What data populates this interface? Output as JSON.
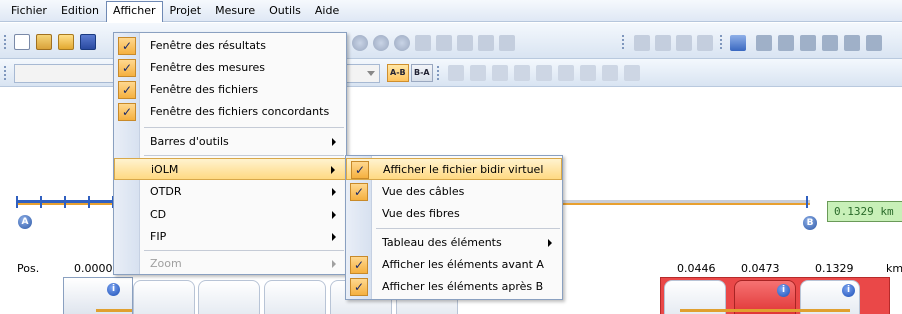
{
  "menubar": {
    "items": [
      "Fichier",
      "Edition",
      "Afficher",
      "Projet",
      "Mesure",
      "Outils",
      "Aide"
    ]
  },
  "toolbar": {
    "ab_label": "A-B",
    "ba_label": "B-A"
  },
  "afficher_menu": {
    "items": [
      {
        "label": "Fenêtre des résultats",
        "checked": true
      },
      {
        "label": "Fenêtre des mesures",
        "checked": true
      },
      {
        "label": "Fenêtre des fichiers",
        "checked": true
      },
      {
        "label": "Fenêtre des fichiers concordants",
        "checked": true
      },
      {
        "label": "Barres d'outils",
        "submenu": true
      },
      {
        "label": "iOLM",
        "submenu": true,
        "highlighted": true
      },
      {
        "label": "OTDR",
        "submenu": true
      },
      {
        "label": "CD",
        "submenu": true
      },
      {
        "label": "FIP",
        "submenu": true
      },
      {
        "label": "Zoom",
        "submenu": true,
        "disabled": true
      }
    ]
  },
  "iolm_submenu": {
    "items": [
      {
        "label": "Afficher le fichier bidir virtuel",
        "checked": true,
        "highlighted": true
      },
      {
        "label": "Vue des câbles",
        "checked": true
      },
      {
        "label": "Vue des fibres",
        "checked": false
      },
      {
        "label": "Tableau des éléments",
        "submenu": true
      },
      {
        "label": "Afficher les éléments avant A",
        "checked": true
      },
      {
        "label": "Afficher les éléments après B",
        "checked": true
      }
    ]
  },
  "trace": {
    "marker_a": "A",
    "marker_b": "B",
    "distance": "0.1329 km"
  },
  "positions": {
    "label": "Pos.",
    "start": "0.0000",
    "values": [
      "0.0446",
      "0.0473",
      "0.1329"
    ],
    "unit": "km"
  },
  "info_symbol": "i",
  "check_symbol": "✓",
  "colors": {
    "accent_highlight": "#ffd982",
    "check_bg": "#f5b040",
    "distance_bg": "#c8f0b8",
    "red_panel": "#ea4848",
    "trace_blue": "#3060c0"
  }
}
